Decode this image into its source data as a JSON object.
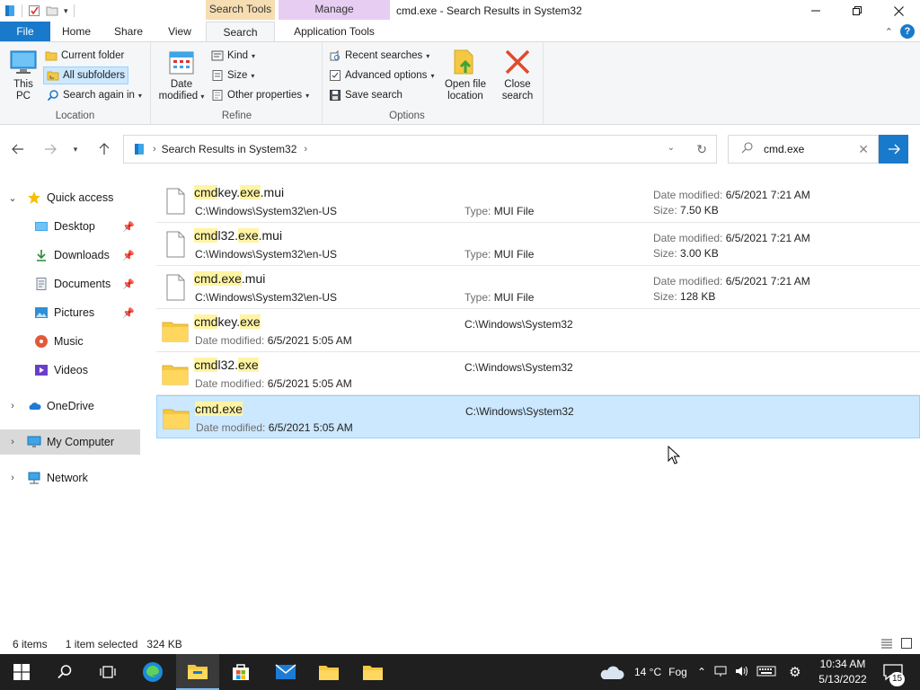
{
  "window": {
    "title": "cmd.exe - Search Results in System32",
    "context_tab_search": "Search Tools",
    "context_tab_manage": "Manage",
    "minimize_glyph": "—",
    "maximize_glyph": "❐",
    "close_glyph": "✕"
  },
  "tabs": {
    "file": "File",
    "home": "Home",
    "share": "Share",
    "view": "View",
    "search": "Search",
    "application_tools": "Application Tools"
  },
  "ribbon": {
    "location": {
      "label": "Location",
      "this_pc": "This PC",
      "current_folder": "Current folder",
      "all_subfolders": "All subfolders",
      "search_again_in": "Search again in"
    },
    "refine": {
      "label": "Refine",
      "date_modified_1": "Date",
      "date_modified_2": "modified",
      "kind": "Kind",
      "size": "Size",
      "other_properties": "Other properties"
    },
    "options": {
      "label": "Options",
      "recent_searches": "Recent searches",
      "advanced_options": "Advanced options",
      "save_search": "Save search",
      "open_file_location_1": "Open file",
      "open_file_location_2": "location",
      "close_search_1": "Close",
      "close_search_2": "search"
    }
  },
  "address": {
    "crumb": "Search Results in System32",
    "search_value": "cmd.exe"
  },
  "nav": {
    "quick_access": "Quick access",
    "desktop": "Desktop",
    "downloads": "Downloads",
    "documents": "Documents",
    "pictures": "Pictures",
    "music": "Music",
    "videos": "Videos",
    "onedrive": "OneDrive",
    "my_computer": "My Computer",
    "network": "Network"
  },
  "results": [
    {
      "name_parts": [
        "cmd",
        "key.",
        "exe",
        ".mui"
      ],
      "path": "C:\\Windows\\System32\\en-US",
      "type_key": "Type:",
      "type_val": "MUI File",
      "date_key": "Date modified:",
      "date_val": "6/5/2021 7:21 AM",
      "size_key": "Size:",
      "size_val": "7.50 KB"
    },
    {
      "name_parts": [
        "cmd",
        "l32.",
        "exe",
        ".mui"
      ],
      "path": "C:\\Windows\\System32\\en-US",
      "type_key": "Type:",
      "type_val": "MUI File",
      "date_key": "Date modified:",
      "date_val": "6/5/2021 7:21 AM",
      "size_key": "Size:",
      "size_val": "3.00 KB"
    },
    {
      "name_parts": [
        "cmd",
        ".",
        "exe",
        ".mui"
      ],
      "path": "C:\\Windows\\System32\\en-US",
      "type_key": "Type:",
      "type_val": "MUI File",
      "date_key": "Date modified:",
      "date_val": "6/5/2021 7:21 AM",
      "size_key": "Size:",
      "size_val": "128 KB"
    },
    {
      "name_parts": [
        "cmd",
        "key.",
        "exe",
        ""
      ],
      "date_key": "Date modified:",
      "date_val": "6/5/2021 5:05 AM",
      "location": "C:\\Windows\\System32"
    },
    {
      "name_parts": [
        "cmd",
        "l32.",
        "exe",
        ""
      ],
      "date_key": "Date modified:",
      "date_val": "6/5/2021 5:05 AM",
      "location": "C:\\Windows\\System32"
    },
    {
      "name_parts": [
        "cmd",
        ".",
        "exe",
        ""
      ],
      "date_key": "Date modified:",
      "date_val": "6/5/2021 5:05 AM",
      "location": "C:\\Windows\\System32"
    }
  ],
  "status": {
    "items": "6 items",
    "selected": "1 item selected",
    "size": "324 KB"
  },
  "taskbar": {
    "weather_temp": "14 °C",
    "weather_desc": "Fog",
    "time": "10:34 AM",
    "date": "5/13/2022",
    "notification_count": "15"
  },
  "colors": {
    "accent": "#1979ca",
    "selection": "#cce8ff",
    "highlight": "#fff4a3",
    "folder": "#f5c842"
  }
}
